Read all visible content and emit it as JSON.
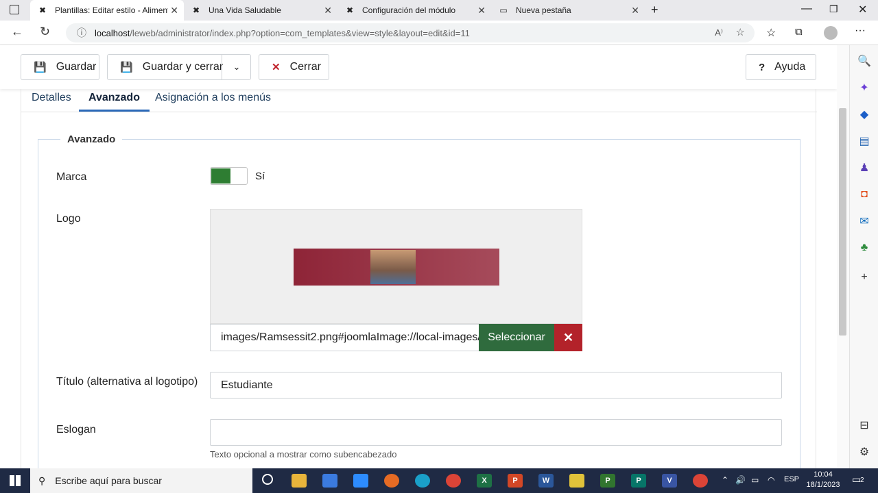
{
  "browser": {
    "tabs": [
      {
        "title": "Plantillas: Editar estilo - Alimento",
        "active": true
      },
      {
        "title": "Una Vida Saludable",
        "active": false
      },
      {
        "title": "Configuración del módulo",
        "active": false
      },
      {
        "title": "Nueva pestaña",
        "active": false
      }
    ],
    "url_host": "localhost",
    "url_path": "/leweb/administrator/index.php?option=com_templates&view=style&layout=edit&id=11"
  },
  "toolbar": {
    "save_label": "Guardar",
    "save_close_label": "Guardar y cerrar",
    "close_label": "Cerrar",
    "help_label": "Ayuda"
  },
  "page_tabs": {
    "details": "Detalles",
    "advanced": "Avanzado",
    "menu_assign": "Asignación a los menús"
  },
  "fieldset": {
    "legend": "Avanzado",
    "brand_label": "Marca",
    "brand_toggle_value": "Sí",
    "logo_label": "Logo",
    "logo_path": "images/Ramsessit2.png#joomlaImage://local-images/",
    "select_label": "Seleccionar",
    "clear_label": "✕",
    "title_label": "Título (alternativa al logotipo)",
    "title_value": "Estudiante",
    "slogan_label": "Eslogan",
    "slogan_value": "",
    "slogan_hint": "Texto opcional a mostrar como subencabezado"
  },
  "taskbar": {
    "search_placeholder": "Escribe aquí para buscar",
    "language": "ESP",
    "time": "10:04",
    "date": "18/1/2023",
    "notifications": "2"
  },
  "colors": {
    "accent": "#2a69b8",
    "green": "#2e7d32",
    "red": "#b3222a"
  }
}
